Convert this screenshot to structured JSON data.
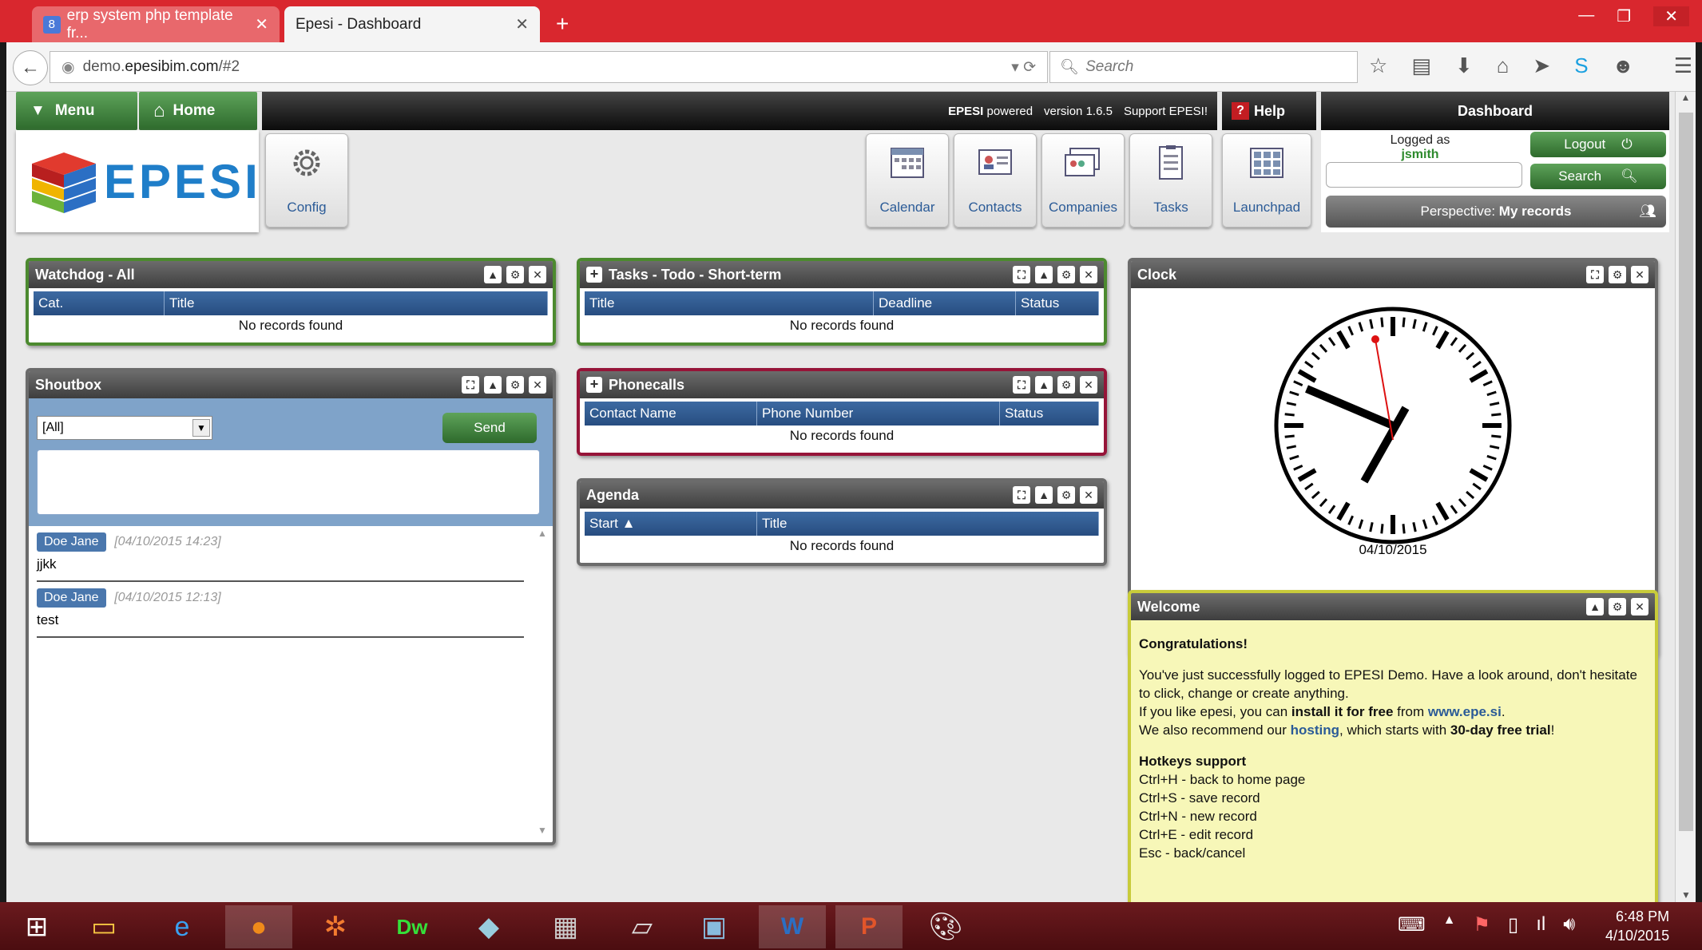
{
  "browser": {
    "tabs": [
      {
        "label": "erp system php template fr...",
        "active": false
      },
      {
        "label": "Epesi - Dashboard",
        "active": true
      }
    ],
    "url_prefix": "demo.",
    "url_host": "epesibim.com",
    "url_path": "/#2",
    "search_placeholder": "Search"
  },
  "header": {
    "menu_label": "Menu",
    "home_label": "Home",
    "powered_brand": "EPESI",
    "powered_word": "powered",
    "version": "version 1.6.5",
    "support": "Support EPESI!",
    "help_label": "Help",
    "dashboard_label": "Dashboard",
    "logo_text": "EPESI",
    "config_label": "Config",
    "apps": [
      "Calendar",
      "Contacts",
      "Companies",
      "Tasks"
    ],
    "launchpad_label": "Launchpad",
    "logged_as": "Logged as",
    "username": "jsmith",
    "logout_label": "Logout",
    "search_label": "Search",
    "perspective_label": "Perspective:",
    "perspective_value": "My records"
  },
  "watchdog": {
    "title": "Watchdog - All",
    "columns": [
      "Cat.",
      "Title"
    ],
    "empty": "No records found"
  },
  "tasks": {
    "title": "Tasks - Todo - Short-term",
    "columns": [
      "Title",
      "Deadline",
      "Status"
    ],
    "empty": "No records found"
  },
  "phonecalls": {
    "title": "Phonecalls",
    "columns": [
      "Contact Name",
      "Phone Number",
      "Status"
    ],
    "empty": "No records found"
  },
  "agenda": {
    "title": "Agenda",
    "columns": [
      "Start ▲",
      "Title"
    ],
    "empty": "No records found"
  },
  "shoutbox": {
    "title": "Shoutbox",
    "select_value": "[All]",
    "send_label": "Send",
    "messages": [
      {
        "author": "Doe Jane",
        "time": "[04/10/2015 14:23]",
        "text": "jjkk"
      },
      {
        "author": "Doe Jane",
        "time": "[04/10/2015 12:13]",
        "text": "test"
      }
    ]
  },
  "clock": {
    "title": "Clock",
    "date": "04/10/2015"
  },
  "welcome": {
    "title": "Welcome",
    "heading": "Congratulations!",
    "p1": "You've just successfully logged to EPESI Demo. Have a look around, don't hesitate to click, change or create anything.",
    "p2_a": "If you like epesi, you can ",
    "p2_b": "install it for free",
    "p2_c": " from ",
    "p2_link": "www.epe.si",
    "p2_d": ".",
    "p3_a": "We also recommend our ",
    "p3_link": "hosting",
    "p3_b": ", which starts with ",
    "p3_c": "30-day free trial",
    "p3_d": "!",
    "hotkeys_title": "Hotkeys support",
    "hotkeys": [
      "Ctrl+H - back to home page",
      "Ctrl+S - save record",
      "Ctrl+N - new record",
      "Ctrl+E - edit record",
      "Esc - back/cancel"
    ]
  },
  "taskbar": {
    "time": "6:48 PM",
    "date": "4/10/2015"
  },
  "colors": {
    "accent_green": "#2e6a2c",
    "table_header_blue": "#274d80",
    "titlebar_red": "#d9272e",
    "phonecalls_border": "#961438"
  }
}
